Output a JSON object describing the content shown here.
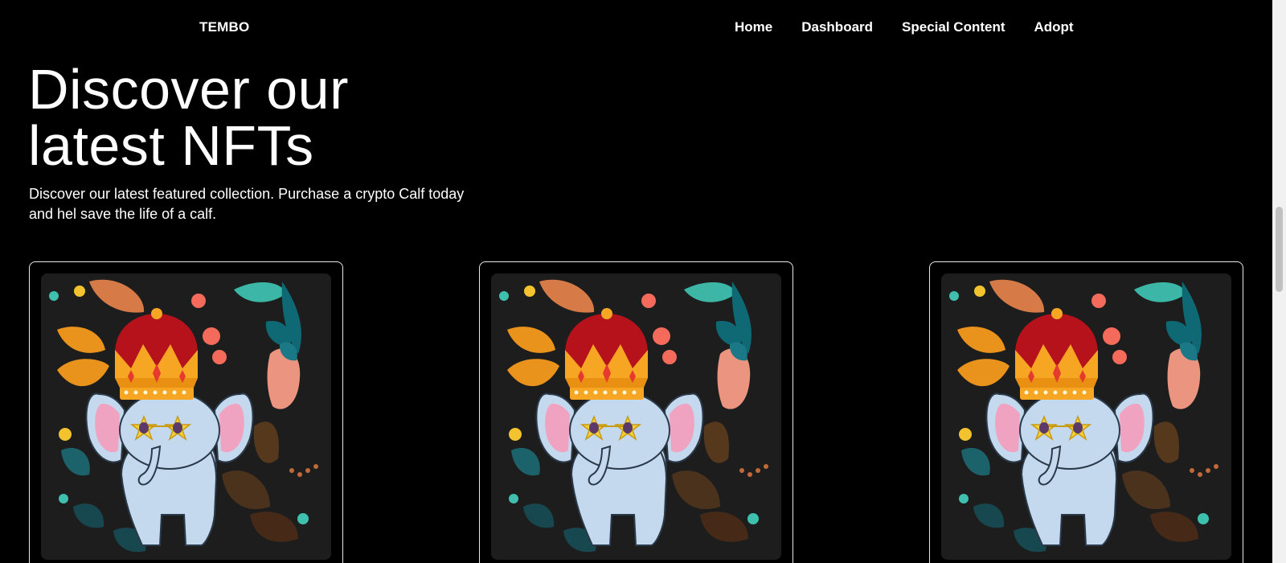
{
  "header": {
    "brand": "TEMBO",
    "nav": [
      {
        "label": "Home"
      },
      {
        "label": "Dashboard"
      },
      {
        "label": "Special Content"
      },
      {
        "label": "Adopt"
      }
    ]
  },
  "hero": {
    "title_line1": "Discover our",
    "title_line2": "latest NFTs",
    "subtitle": "Discover our latest featured collection. Purchase a crypto Calf today and hel save the life of a calf."
  },
  "cards": [
    {
      "art": "crowned-elephant-nft-icon"
    },
    {
      "art": "crowned-elephant-nft-icon"
    },
    {
      "art": "crowned-elephant-nft-icon"
    }
  ],
  "colors": {
    "background": "#000000",
    "text": "#ffffff",
    "card_border": "#e8e8e8",
    "art_background": "#1d1d1d",
    "crown_red": "#b5121b",
    "crown_gold": "#f6a623",
    "elephant": "#c5d9ee",
    "ear_pink": "#f0a3c0"
  }
}
